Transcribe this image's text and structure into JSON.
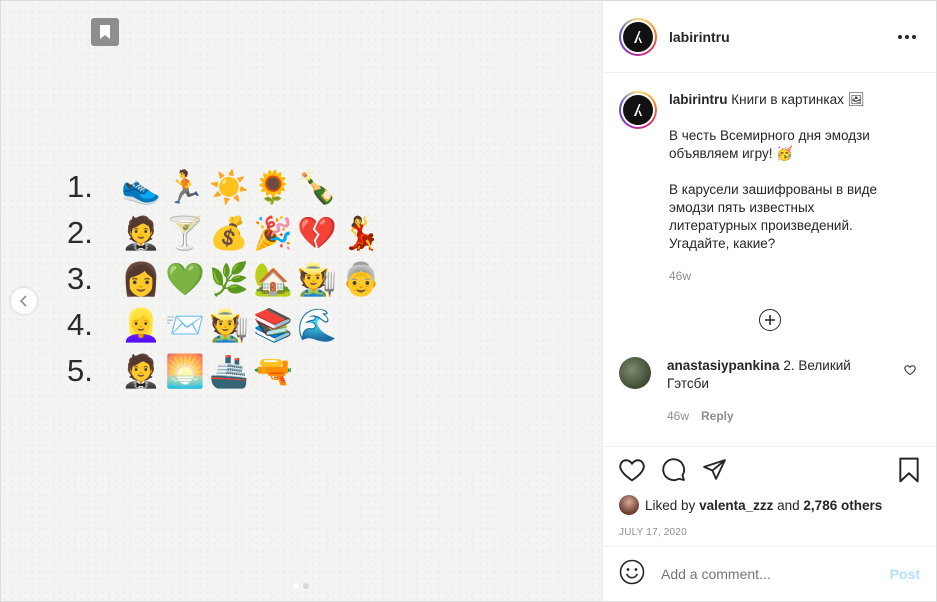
{
  "post": {
    "numbers": [
      "1.",
      "2.",
      "3.",
      "4.",
      "5."
    ],
    "rows": [
      [
        "👟",
        "🏃",
        "☀️",
        "🌻",
        "🍾"
      ],
      [
        "🤵",
        "🍸",
        "💰",
        "🎉",
        "💔",
        "💃"
      ],
      [
        "👩",
        "💚",
        "🌿",
        "🏡",
        "🧑‍🌾",
        "👵"
      ],
      [
        "👱‍♀️",
        "📨",
        "🧑‍🌾",
        "📚",
        "🌊"
      ],
      [
        "🤵",
        "🌅",
        "🚢",
        "🔫"
      ]
    ],
    "carousel_dots": 2
  },
  "header": {
    "username": "labirintru"
  },
  "caption": {
    "username": "labirintru",
    "line1": "Книги в картинках 🖼",
    "para2": "В честь Всемирного дня эмодзи объявляем игру! 🥳",
    "para3": "В карусели зашифрованы в виде эмодзи пять известных литературных произведений. Угадайте, какие?",
    "time": "46w"
  },
  "comment": {
    "username": "anastasiypankina",
    "text": "2. Великий Гэтсби",
    "time": "46w",
    "reply_label": "Reply"
  },
  "likes": {
    "prefix": "Liked by",
    "user": "valenta_zzz",
    "middle": "and",
    "count": "2,786 others"
  },
  "date": "JULY 17, 2020",
  "add_comment": {
    "placeholder": "Add a comment...",
    "post_label": "Post"
  },
  "icons": {
    "bookmark": "bookmark-icon",
    "prev": "chevron-left-icon",
    "more": "more-options-icon",
    "load_more": "plus-circle-icon",
    "heart": "heart-icon",
    "comment": "comment-icon",
    "share": "paper-plane-icon",
    "save": "save-icon",
    "emoji": "smiley-icon"
  },
  "colors": {
    "post_disabled": "#b2dffc",
    "muted": "#8e8e8e",
    "text": "#262626"
  }
}
